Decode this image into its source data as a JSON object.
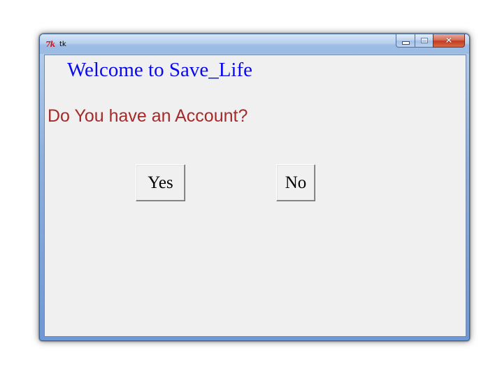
{
  "window": {
    "title": "tk",
    "icon": "tk-icon",
    "controls": {
      "minimize": "minimize-icon",
      "maximize": "maximize-icon",
      "close": "close-icon"
    }
  },
  "content": {
    "heading": "Welcome to Save_Life",
    "question": "Do You have an Account?",
    "yes_label": "Yes",
    "no_label": "No"
  },
  "colors": {
    "heading": "#0a0af0",
    "question": "#a52a2a",
    "background": "#f0f0f0"
  }
}
